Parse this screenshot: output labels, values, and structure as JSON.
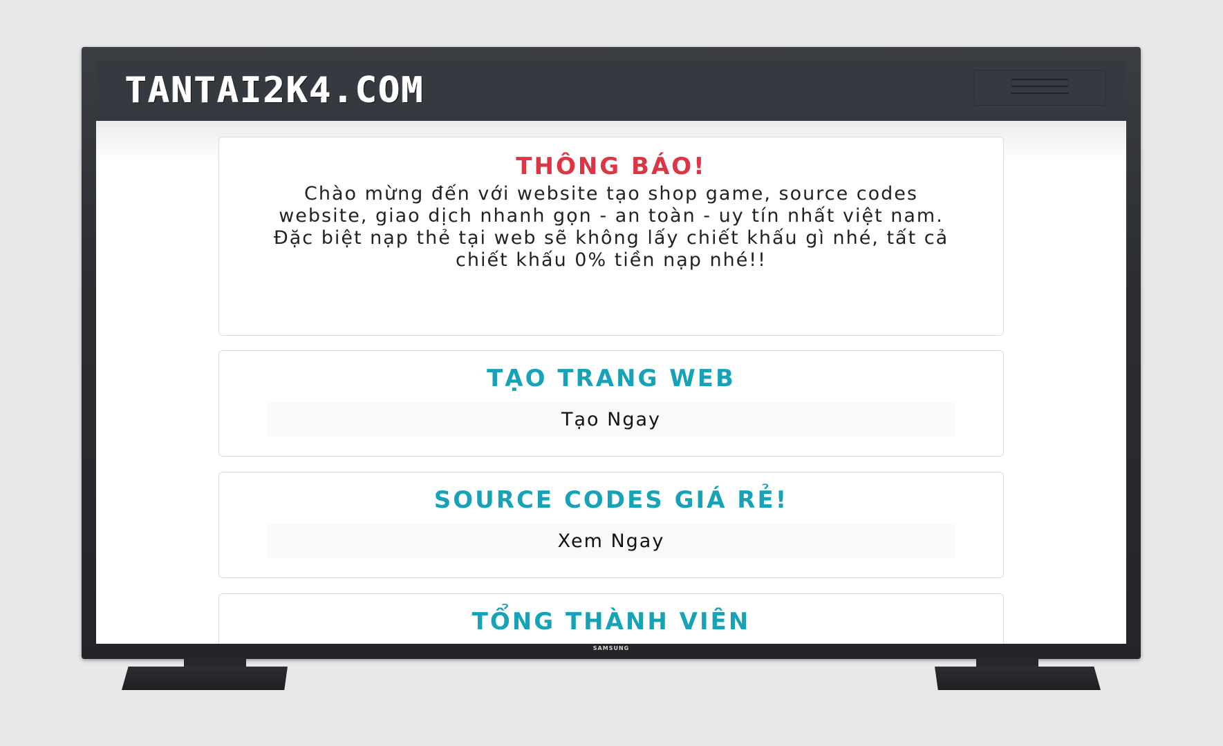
{
  "navbar": {
    "brand": "TANTAI2K4.COM",
    "menu_icon": "hamburger-menu-icon"
  },
  "tv": {
    "brand": "SAMSUNG"
  },
  "notice": {
    "title": "THÔNG BÁO!",
    "text": "Chào mừng đến với website tạo shop game, source codes website, giao dịch nhanh gọn - an toàn - uy tín nhất việt nam. Đặc biệt nạp thẻ tại web sẽ không lấy chiết khấu gì nhé, tất cả chiết khấu 0% tiền nạp nhé!!"
  },
  "create_web": {
    "title": "TẠO TRANG WEB",
    "button": "Tạo Ngay"
  },
  "source_codes": {
    "title": "SOURCE CODES GIÁ RẺ!",
    "button": "Xem Ngay"
  },
  "members": {
    "title": "TỔNG THÀNH VIÊN"
  },
  "colors": {
    "navbar": "#343a40",
    "red_title": "#dc3545",
    "cyan_title": "#17a2b8",
    "button_bg": "#f8f9fa"
  }
}
